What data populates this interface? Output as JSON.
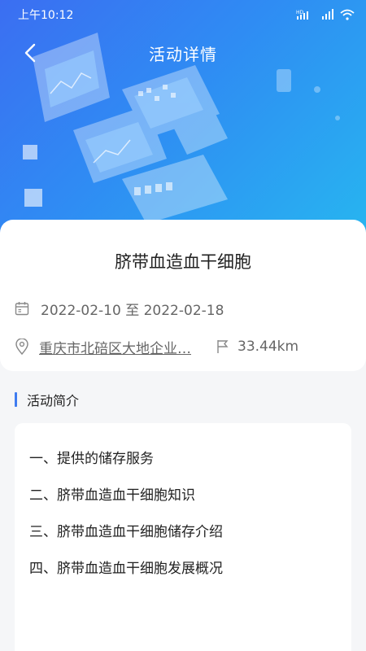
{
  "status_bar": {
    "time": "上午10:12",
    "icons": [
      "hd-signal-icon",
      "signal-icon",
      "wifi-icon"
    ]
  },
  "header": {
    "title": "活动详情",
    "back_icon": "chevron-left-icon"
  },
  "event": {
    "title": "脐带血造血干细胞",
    "date_range": "2022-02-10 至 2022-02-18",
    "address": "重庆市北碚区大地企业…",
    "distance": "33.44km"
  },
  "intro": {
    "section_title": "活动简介",
    "items": [
      "一、提供的储存服务",
      "二、脐带血造血干细胞知识",
      "三、脐带血造血干细胞储存介绍",
      "四、脐带血造血干细胞发展概况"
    ]
  },
  "colors": {
    "hero_start": "#3b6ef2",
    "hero_end": "#27b6f0",
    "accent": "#3f7cf0",
    "background": "#f5f6f8"
  }
}
